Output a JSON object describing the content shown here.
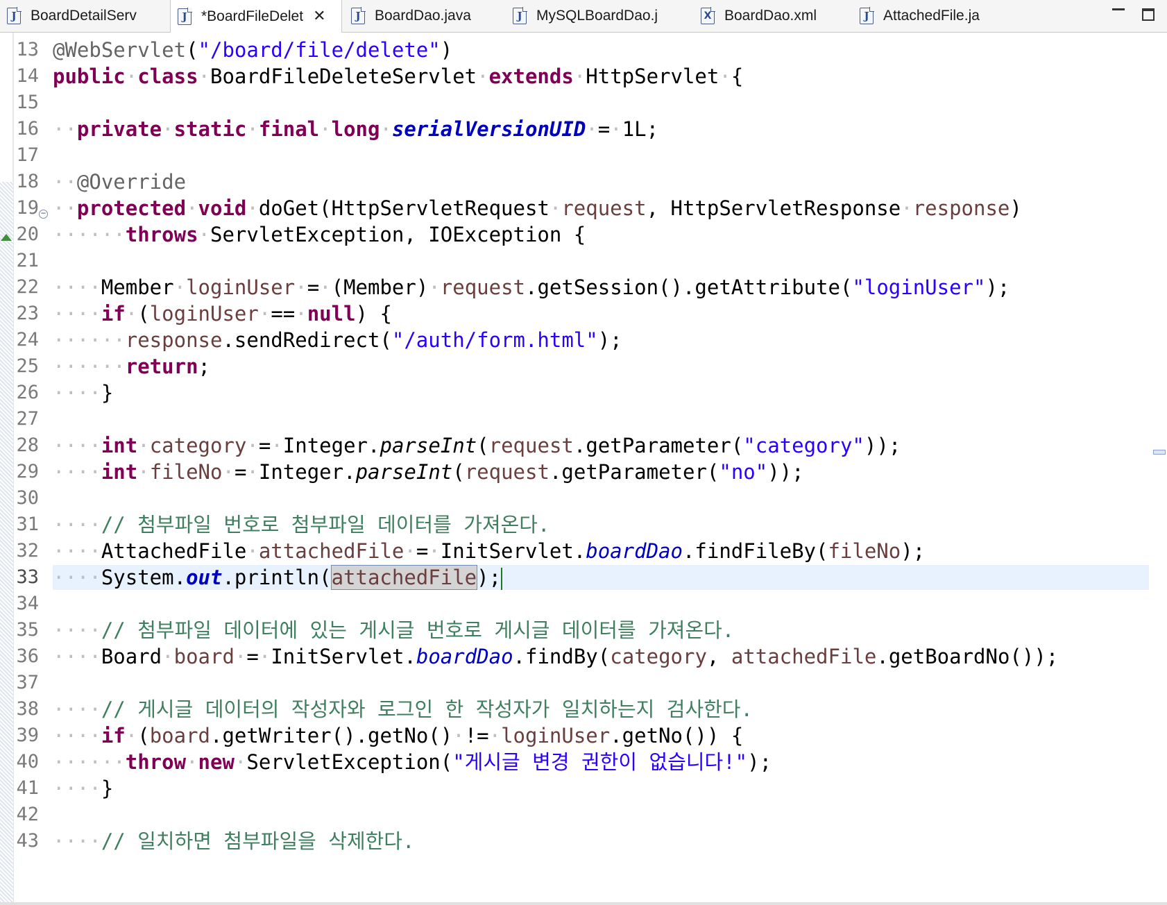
{
  "tabs": [
    {
      "label": "BoardDetailServ",
      "icon": "java-file-icon",
      "active": false
    },
    {
      "label": "*BoardFileDelet",
      "icon": "java-file-icon",
      "active": true,
      "close": "✕"
    },
    {
      "label": "BoardDao.java",
      "icon": "java-file-icon",
      "active": false
    },
    {
      "label": "MySQLBoardDao.j",
      "icon": "java-file-icon",
      "active": false
    },
    {
      "label": "BoardDao.xml",
      "icon": "xml-file-icon",
      "active": false
    },
    {
      "label": "AttachedFile.ja",
      "icon": "java-file-icon",
      "active": false
    }
  ],
  "window_controls": {
    "minimize": "minimize-icon",
    "maximize": "maximize-icon"
  },
  "editor": {
    "current_line": 33,
    "lines": [
      {
        "n": "13"
      },
      {
        "n": "14"
      },
      {
        "n": "15"
      },
      {
        "n": "16"
      },
      {
        "n": "17"
      },
      {
        "n": "18"
      },
      {
        "n": "19"
      },
      {
        "n": "20"
      },
      {
        "n": "21"
      },
      {
        "n": "22"
      },
      {
        "n": "23"
      },
      {
        "n": "24"
      },
      {
        "n": "25"
      },
      {
        "n": "26"
      },
      {
        "n": "27"
      },
      {
        "n": "28"
      },
      {
        "n": "29"
      },
      {
        "n": "30"
      },
      {
        "n": "31"
      },
      {
        "n": "32"
      },
      {
        "n": "33"
      },
      {
        "n": "34"
      },
      {
        "n": "35"
      },
      {
        "n": "36"
      },
      {
        "n": "37"
      },
      {
        "n": "38"
      },
      {
        "n": "39"
      },
      {
        "n": "40"
      },
      {
        "n": "41"
      },
      {
        "n": "42"
      },
      {
        "n": "43"
      }
    ],
    "tokens": {
      "l13": {
        "a1": "@WebServlet",
        "p1": "(",
        "s1": "\"/board/file/delete\"",
        "p2": ")"
      },
      "l14": {
        "k1": "public",
        "k2": "class",
        "t1": "BoardFileDeleteServlet",
        "k3": "extends",
        "t2": "HttpServlet",
        "p1": "{"
      },
      "l16": {
        "k1": "private",
        "k2": "static",
        "k3": "final",
        "k4": "long",
        "f1": "serialVersionUID",
        "p1": "=",
        "t1": "1L;"
      },
      "l18": {
        "a1": "@Override"
      },
      "l19": {
        "k1": "protected",
        "k2": "void",
        "t1": "doGet(HttpServletRequest",
        "v1": "request",
        "t2": ", HttpServletResponse",
        "v2": "response",
        "t3": ")"
      },
      "l20": {
        "k1": "throws",
        "t1": "ServletException, IOException {"
      },
      "l22": {
        "t1": "Member",
        "v1": "loginUser",
        "t2": "=",
        "t3": "(Member)",
        "v2": "request",
        "t4": ".getSession().getAttribute(",
        "s1": "\"loginUser\"",
        "t5": ");"
      },
      "l23": {
        "k1": "if",
        "t1": "(",
        "v1": "loginUser",
        "t2": "==",
        "k2": "null",
        "t3": ") {"
      },
      "l24": {
        "v1": "response",
        "t1": ".sendRedirect(",
        "s1": "\"/auth/form.html\"",
        "t2": ");"
      },
      "l25": {
        "k1": "return",
        "t1": ";"
      },
      "l26": {
        "t1": "}"
      },
      "l28": {
        "k1": "int",
        "v1": "category",
        "t1": "=",
        "t2": "Integer.",
        "m1": "parseInt",
        "t3": "(",
        "v2": "request",
        "t4": ".getParameter(",
        "s1": "\"category\"",
        "t5": "));"
      },
      "l29": {
        "k1": "int",
        "v1": "fileNo",
        "t1": "=",
        "t2": "Integer.",
        "m1": "parseInt",
        "t3": "(",
        "v2": "request",
        "t4": ".getParameter(",
        "s1": "\"no\"",
        "t5": "));"
      },
      "l31": {
        "c1": "// 첨부파일 번호로 첨부파일 데이터를 가져온다."
      },
      "l32": {
        "t1": "AttachedFile",
        "v1": "attachedFile",
        "t2": "=",
        "t3": "InitServlet.",
        "f1": "boardDao",
        "t4": ".findFileBy(",
        "v2": "fileNo",
        "t5": ");"
      },
      "l33": {
        "t1": "System.",
        "f1": "out",
        "t2": ".println(",
        "v1": "attachedFile",
        "t3": ");"
      },
      "l35": {
        "c1": "// 첨부파일 데이터에 있는 게시글 번호로 게시글 데이터를 가져온다."
      },
      "l36": {
        "t1": "Board",
        "v1": "board",
        "t2": "=",
        "t3": "InitServlet.",
        "f1": "boardDao",
        "t4": ".findBy(",
        "v2": "category",
        "t5": ", ",
        "v3": "attachedFile",
        "t6": ".getBoardNo());"
      },
      "l38": {
        "c1": "// 게시글 데이터의 작성자와 로그인 한 작성자가 일치하는지 검사한다."
      },
      "l39": {
        "k1": "if",
        "t1": "(",
        "v1": "board",
        "t2": ".getWriter().getNo()",
        "t3": "!=",
        "v2": "loginUser",
        "t4": ".getNo()) {"
      },
      "l40": {
        "k1": "throw",
        "k2": "new",
        "t1": "ServletException(",
        "s1": "\"게시글 변경 권한이 없습니다!\"",
        "t2": ");"
      },
      "l41": {
        "t1": "}"
      },
      "l43": {
        "c1": "// 일치하면 첨부파일을 삭제한다."
      }
    }
  }
}
